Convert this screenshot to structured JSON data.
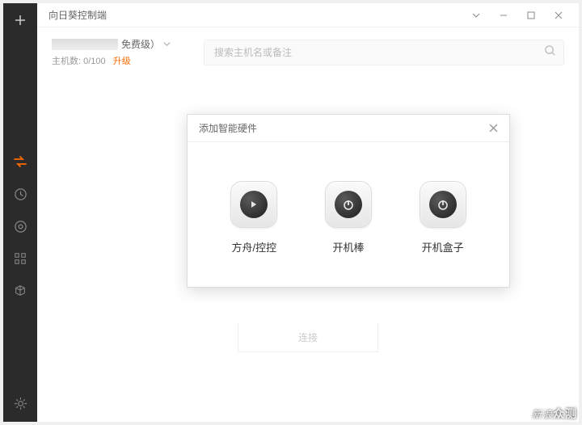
{
  "titlebar": {
    "title": "向日葵控制端"
  },
  "account": {
    "tier": "免费级）",
    "hosts_prefix": "主机数:",
    "hosts_count": "0/100",
    "upgrade": "升级"
  },
  "search": {
    "placeholder": "搜索主机名或备注"
  },
  "connect": {
    "label": "连接"
  },
  "modal": {
    "title": "添加智能硬件",
    "items": [
      {
        "label": "方舟/控控",
        "icon": "play"
      },
      {
        "label": "开机棒",
        "icon": "power"
      },
      {
        "label": "开机盒子",
        "icon": "power"
      }
    ]
  },
  "watermark": {
    "brand": "新浪",
    "sub": "众测"
  }
}
